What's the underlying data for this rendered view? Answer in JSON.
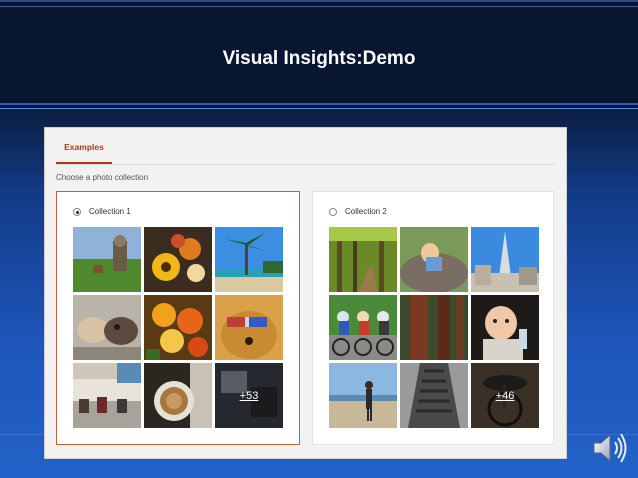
{
  "slide": {
    "title": "Visual Insights:Demo"
  },
  "panel": {
    "tab_label": "Examples",
    "instruction": "Choose a photo collection",
    "collections": [
      {
        "label": "Collection 1",
        "selected": true,
        "more_count": "+53"
      },
      {
        "label": "Collection 2",
        "selected": false,
        "more_count": "+46"
      }
    ]
  },
  "colors": {
    "accent": "#b03a1e",
    "selected_border": "#c9603a",
    "slide_header": "#081631",
    "slide_background": "#1d55b8"
  },
  "icons": {
    "speaker": "speaker-icon"
  }
}
